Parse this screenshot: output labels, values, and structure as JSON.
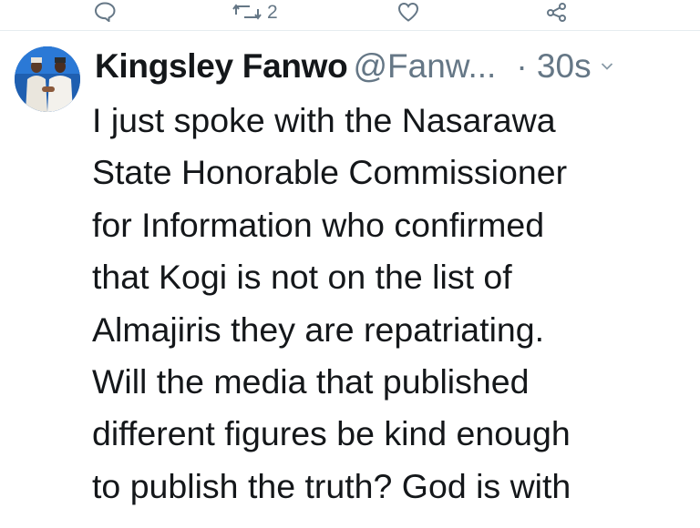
{
  "actions": {
    "reply": {
      "icon": "reply-icon"
    },
    "retweet": {
      "icon": "retweet-icon",
      "count": "2"
    },
    "like": {
      "icon": "heart-icon"
    },
    "share": {
      "icon": "share-icon"
    }
  },
  "tweet": {
    "author_name": "Kingsley Fanwo",
    "handle": "@Fanw...",
    "time": "· 30s",
    "lines": [
      "I just spoke with the Nasarawa",
      "State Honorable Commissioner",
      "for Information who confirmed",
      "that Kogi is not on the list of",
      "Almajiris they are repatriating.",
      "Will the media that published",
      "different figures be kind enough",
      "to publish the truth? God is with"
    ]
  },
  "colors": {
    "text": "#14171a",
    "muted": "#657786",
    "link": "#1da1f2"
  }
}
